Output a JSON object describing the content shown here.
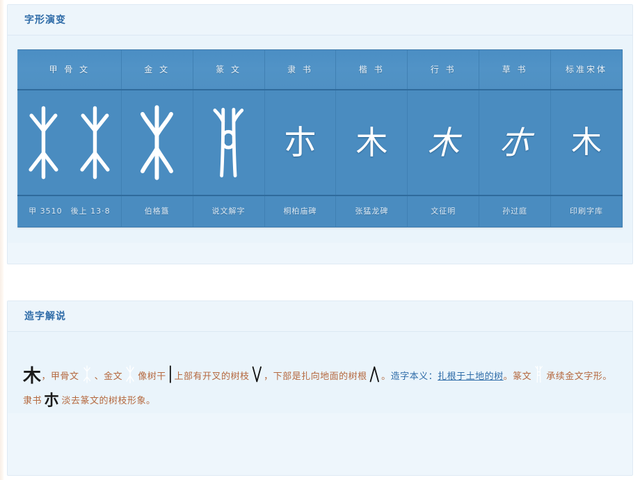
{
  "panels": {
    "evolution": {
      "title": "字形演变",
      "columns": [
        {
          "script": "甲 骨 文",
          "sources": [
            "甲 3510",
            "後上 13·8"
          ],
          "glyph_kind": "oracle",
          "glyph_char": "木"
        },
        {
          "script": "金 文",
          "sources": [
            "伯格簋"
          ],
          "glyph_kind": "bronze",
          "glyph_char": "木"
        },
        {
          "script": "篆 文",
          "sources": [
            "说文解字"
          ],
          "glyph_kind": "seal",
          "glyph_char": "木"
        },
        {
          "script": "隶 书",
          "sources": [
            "桐柏庙碑"
          ],
          "glyph_kind": "clerical",
          "glyph_char": "朩"
        },
        {
          "script": "楷 书",
          "sources": [
            "张猛龙碑"
          ],
          "glyph_kind": "regular",
          "glyph_char": "木"
        },
        {
          "script": "行 书",
          "sources": [
            "文征明"
          ],
          "glyph_kind": "running",
          "glyph_char": "木"
        },
        {
          "script": "草 书",
          "sources": [
            "孙过庭"
          ],
          "glyph_kind": "cursive",
          "glyph_char": "朩"
        },
        {
          "script": "标准宋体",
          "sources": [
            "印刷字库"
          ],
          "glyph_kind": "song",
          "glyph_char": "木"
        }
      ]
    },
    "explanation": {
      "title": "造字解说",
      "lead_char": "木",
      "segments": [
        {
          "type": "text",
          "value": "，甲骨文"
        },
        {
          "type": "glyph",
          "kind": "oracle"
        },
        {
          "type": "text",
          "value": "、金文"
        },
        {
          "type": "glyph",
          "kind": "bronze"
        },
        {
          "type": "text",
          "value": "像树干"
        },
        {
          "type": "glyph",
          "kind": "trunk"
        },
        {
          "type": "text",
          "value": "上部有开叉的树枝"
        },
        {
          "type": "glyph",
          "kind": "branch-down"
        },
        {
          "type": "text",
          "value": "，下部是扎向地面的树根"
        },
        {
          "type": "glyph",
          "kind": "root-up"
        },
        {
          "type": "text",
          "value": "。"
        },
        {
          "type": "label",
          "value": "造字本义："
        },
        {
          "type": "link",
          "value": "扎根于土地的树"
        },
        {
          "type": "text",
          "value": "。篆文"
        },
        {
          "type": "glyph",
          "kind": "seal"
        },
        {
          "type": "text",
          "value": "承续金文字形。隶书"
        },
        {
          "type": "kai",
          "value": "朩"
        },
        {
          "type": "text",
          "value": "淡去篆文的树枝形象。"
        }
      ]
    }
  },
  "colors": {
    "panel_bg": "#eaf4fb",
    "panel_border": "#dfeaf4",
    "title_blue": "#2f6ca8",
    "table_blue": "#4a8cc0",
    "table_header_blue": "#5193c6",
    "rule_blue": "#2f6b9c",
    "text_brown": "#b5693f",
    "glyph_white": "#ffffff"
  }
}
